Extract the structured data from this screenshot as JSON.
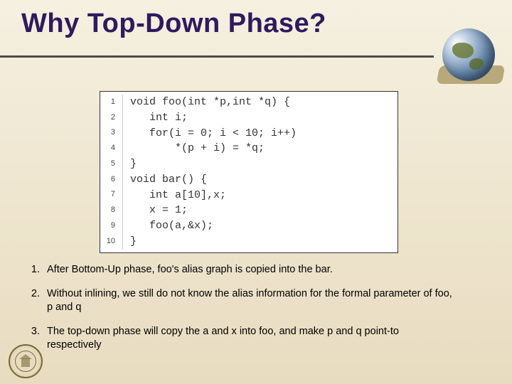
{
  "title": "Why Top-Down Phase?",
  "code": {
    "lines": [
      {
        "n": "1",
        "text": "void foo(int *p,int *q) {"
      },
      {
        "n": "2",
        "text": "   int i;"
      },
      {
        "n": "3",
        "text": "   for(i = 0; i < 10; i++)"
      },
      {
        "n": "4",
        "text": "       *(p + i) = *q;"
      },
      {
        "n": "5",
        "text": "}"
      },
      {
        "n": "6",
        "text": "void bar() {"
      },
      {
        "n": "7",
        "text": "   int a[10],x;"
      },
      {
        "n": "8",
        "text": "   x = 1;"
      },
      {
        "n": "9",
        "text": "   foo(a,&x);"
      },
      {
        "n": "10",
        "text": "}"
      }
    ]
  },
  "bullets": [
    "After Bottom-Up phase, foo's alias graph is copied into the bar.",
    "Without inlining, we still do not know the alias information for the formal parameter of foo, p and q",
    "The top-down phase will copy the a and x into foo, and make p and q point-to respectively"
  ]
}
